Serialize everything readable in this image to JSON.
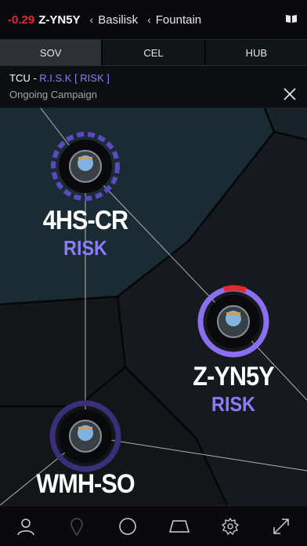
{
  "header": {
    "security": "-0.29",
    "system": "Z-YN5Y",
    "breadcrumbs": [
      "Basilisk",
      "Fountain"
    ]
  },
  "tabs": [
    {
      "label": "SOV",
      "active": true
    },
    {
      "label": "CEL",
      "active": false
    },
    {
      "label": "HUB",
      "active": false
    }
  ],
  "info": {
    "prefix": "TCU - ",
    "campaign": "R.I.S.K [ RISK ]",
    "status": "Ongoing Campaign"
  },
  "nodes": [
    {
      "name": "4HS-CR",
      "alliance": "RISK"
    },
    {
      "name": "Z-YN5Y",
      "alliance": "RISK"
    },
    {
      "name": "WMH-SO",
      "alliance": ""
    }
  ],
  "icons": {
    "book": "book-icon",
    "close": "close-icon",
    "toolbar": [
      "person-icon",
      "map-pin-icon",
      "circle-icon",
      "trapezoid-icon",
      "gear-icon",
      "expand-icon"
    ]
  },
  "colors": {
    "security": "#e02b2b",
    "accent": "#8c7dff",
    "ring": "#6e5ad8",
    "cell_teal": "#1a2b33",
    "cell_dark": "#16181c"
  }
}
